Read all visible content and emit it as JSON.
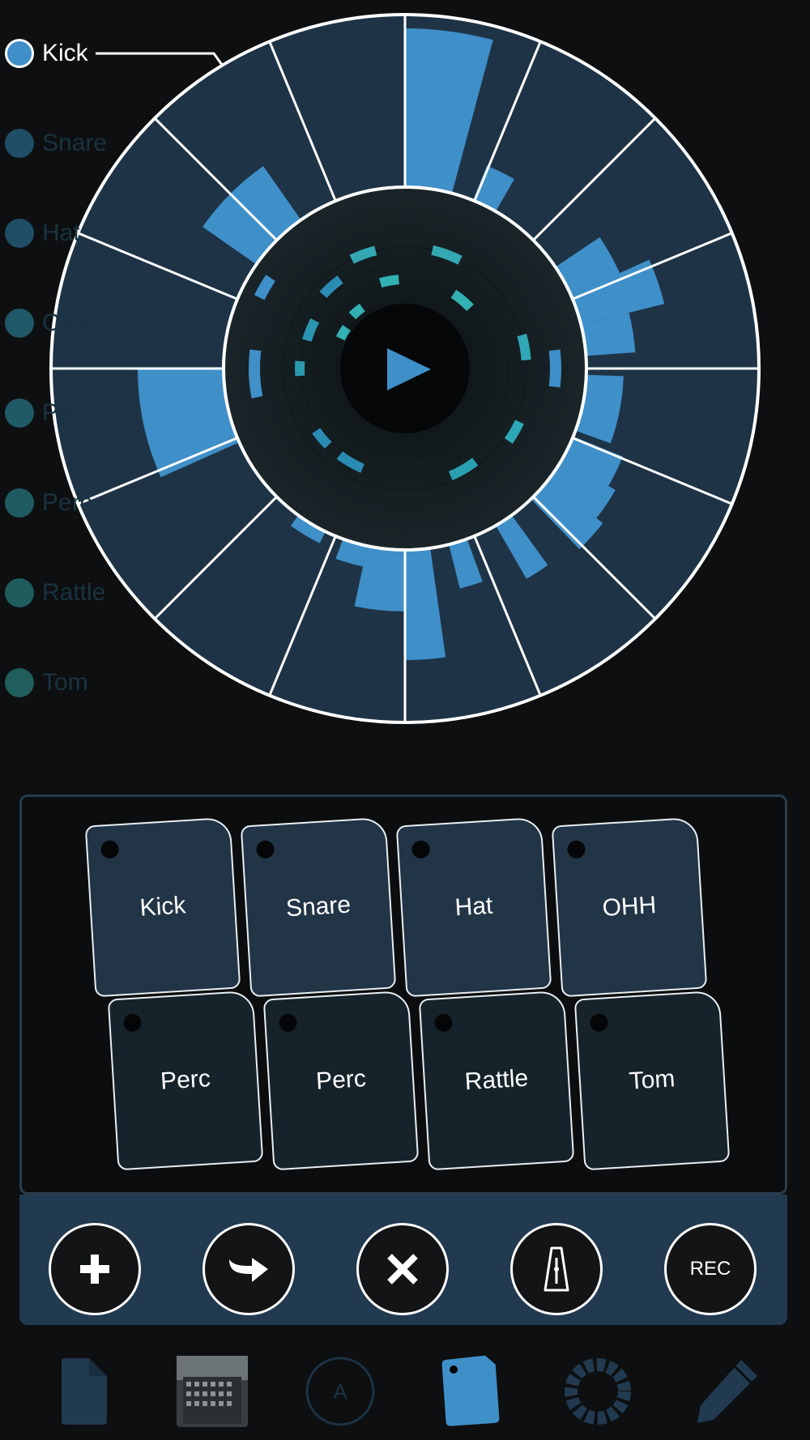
{
  "sequencer": {
    "play_icon": "play-icon",
    "ring_color": "#3f8fc9",
    "rim_color": "#ffffff"
  },
  "tracks": {
    "selected": "Kick",
    "items": [
      {
        "label": "Kick",
        "color": "#3f8fc9"
      },
      {
        "label": "Snare",
        "color": "#1f4e66"
      },
      {
        "label": "Hat",
        "color": "#1f4e66"
      },
      {
        "label": "OHH",
        "color": "#1f5866"
      },
      {
        "label": "Perc",
        "color": "#1f5a66"
      },
      {
        "label": "Perc",
        "color": "#1f5c62"
      },
      {
        "label": "Rattle",
        "color": "#1f5c5e"
      },
      {
        "label": "Tom",
        "color": "#1f5e5a"
      }
    ]
  },
  "pads": {
    "top_row": [
      {
        "label": "Kick"
      },
      {
        "label": "Snare"
      },
      {
        "label": "Hat"
      },
      {
        "label": "OHH"
      }
    ],
    "bottom_row": [
      {
        "label": "Perc"
      },
      {
        "label": "Perc"
      },
      {
        "label": "Rattle"
      },
      {
        "label": "Tom"
      }
    ]
  },
  "actions": {
    "add_icon": "plus-icon",
    "redo_icon": "arrow-right-icon",
    "clear_icon": "close-icon",
    "metronome_icon": "metronome-icon",
    "rec_label": "REC"
  },
  "tab_bar": {
    "items": [
      {
        "icon": "document-icon"
      },
      {
        "icon": "photo-thumbnail"
      },
      {
        "icon": "circle-a-icon",
        "letter": "A"
      },
      {
        "icon": "pad-icon",
        "active": true
      },
      {
        "icon": "ring-icon"
      },
      {
        "icon": "pencil-icon"
      }
    ]
  }
}
